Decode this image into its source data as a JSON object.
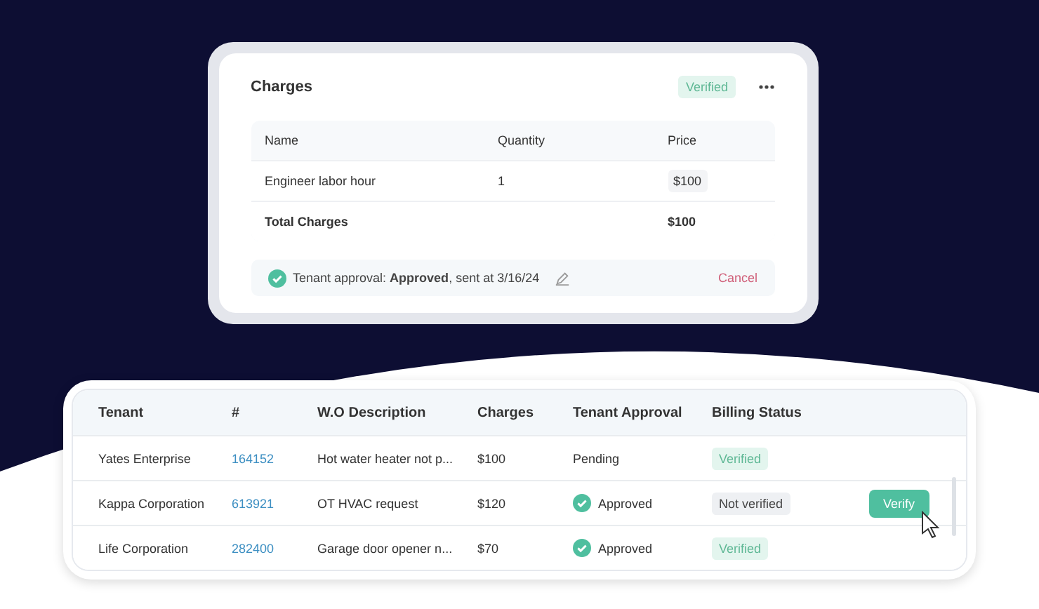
{
  "charges_card": {
    "title": "Charges",
    "status_badge": "Verified",
    "columns": [
      "Name",
      "Quantity",
      "Price"
    ],
    "rows": [
      {
        "name": "Engineer labor hour",
        "quantity": "1",
        "price": "$100"
      }
    ],
    "total": {
      "label": "Total Charges",
      "value": "$100"
    },
    "approval": {
      "label": "Tenant approval: **Approved**, sent at 3/16/24",
      "cancel": "Cancel"
    }
  },
  "work_orders": {
    "columns": [
      "Tenant",
      "#",
      "W.O Description",
      "Charges",
      "Tenant Approval",
      "Billing Status"
    ],
    "rows": [
      {
        "tenant": "Yates Enterprise",
        "number": "164152",
        "description": "Hot water heater not p...",
        "charges": "$100",
        "approval": {
          "kind": "pending",
          "text": "Pending"
        },
        "billing": {
          "kind": "verified",
          "text": "Verified"
        }
      },
      {
        "tenant": "Kappa Corporation",
        "number": "613921",
        "description": "OT HVAC request",
        "charges": "$120",
        "approval": {
          "kind": "approved",
          "text": "Approved"
        },
        "billing": {
          "kind": "not_verified",
          "text": "Not verified"
        },
        "action": "Verify"
      },
      {
        "tenant": "Life Corporation",
        "number": "282400",
        "description": "Garage door opener n...",
        "charges": "$70",
        "approval": {
          "kind": "approved",
          "text": "Approved"
        },
        "billing": {
          "kind": "verified",
          "text": "Verified"
        }
      }
    ]
  }
}
